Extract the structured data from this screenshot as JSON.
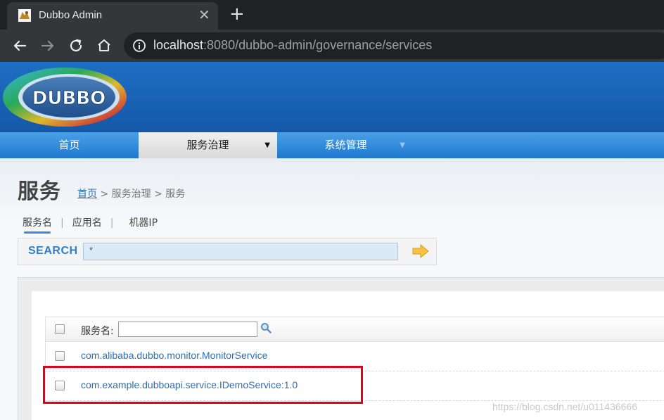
{
  "browser": {
    "tab_title": "Dubbo Admin",
    "close_glyph": "✕",
    "new_tab_glyph": "+",
    "url_host": "localhost",
    "url_rest": ":8080/dubbo-admin/governance/services"
  },
  "header": {
    "logo_text": "DUBBO"
  },
  "nav": {
    "items": [
      {
        "label": "首页"
      },
      {
        "label": "服务治理"
      },
      {
        "label": "系统管理"
      }
    ]
  },
  "page": {
    "title": "服务",
    "breadcrumb_home": "首页",
    "breadcrumb_rest": " > 服务治理 > 服务"
  },
  "filter_tabs": {
    "service_name": "服务名",
    "app_name": "应用名",
    "machine_ip": "机器IP",
    "separator": "|"
  },
  "search": {
    "label": "SEARCH",
    "value": "*"
  },
  "table": {
    "header_label": "服务名:",
    "rows": [
      {
        "service": "com.alibaba.dubbo.monitor.MonitorService"
      },
      {
        "service": "com.example.dubboapi.service.IDemoService:1.0"
      }
    ]
  },
  "watermark": "https://blog.csdn.net/u011436666",
  "colors": {
    "brand_blue": "#1e6ec4",
    "nav_blue": "#1f78cf",
    "link": "#2a6eb8",
    "highlight_red": "#e3001b"
  }
}
